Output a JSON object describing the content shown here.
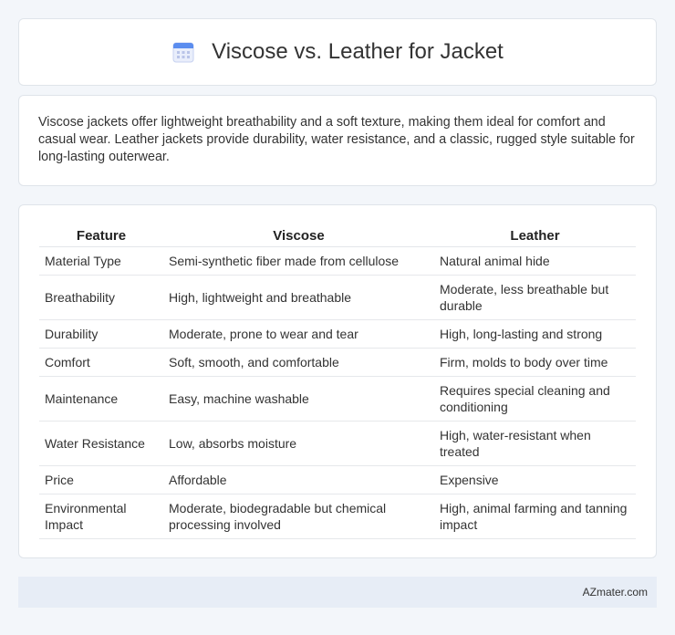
{
  "header": {
    "title": "Viscose vs. Leather for Jacket",
    "icon": "calendar-icon",
    "icon_colors": {
      "top": "#5b8def",
      "body": "#e9eefb",
      "dots": "#b9c4e8"
    }
  },
  "summary": {
    "text": "Viscose jackets offer lightweight breathability and a soft texture, making them ideal for comfort and casual wear. Leather jackets provide durability, water resistance, and a classic, rugged style suitable for long-lasting outerwear."
  },
  "table": {
    "headers": [
      "Feature",
      "Viscose",
      "Leather"
    ],
    "rows": [
      {
        "feature": "Material Type",
        "viscose": "Semi-synthetic fiber made from cellulose",
        "leather": "Natural animal hide"
      },
      {
        "feature": "Breathability",
        "viscose": "High, lightweight and breathable",
        "leather": "Moderate, less breathable but durable"
      },
      {
        "feature": "Durability",
        "viscose": "Moderate, prone to wear and tear",
        "leather": "High, long-lasting and strong"
      },
      {
        "feature": "Comfort",
        "viscose": "Soft, smooth, and comfortable",
        "leather": "Firm, molds to body over time"
      },
      {
        "feature": "Maintenance",
        "viscose": "Easy, machine washable",
        "leather": "Requires special cleaning and conditioning"
      },
      {
        "feature": "Water Resistance",
        "viscose": "Low, absorbs moisture",
        "leather": "High, water-resistant when treated"
      },
      {
        "feature": "Price",
        "viscose": "Affordable",
        "leather": "Expensive"
      },
      {
        "feature": "Environmental Impact",
        "viscose": "Moderate, biodegradable but chemical processing involved",
        "leather": "High, animal farming and tanning impact"
      }
    ]
  },
  "footer": {
    "brand": "AZmater.com"
  }
}
